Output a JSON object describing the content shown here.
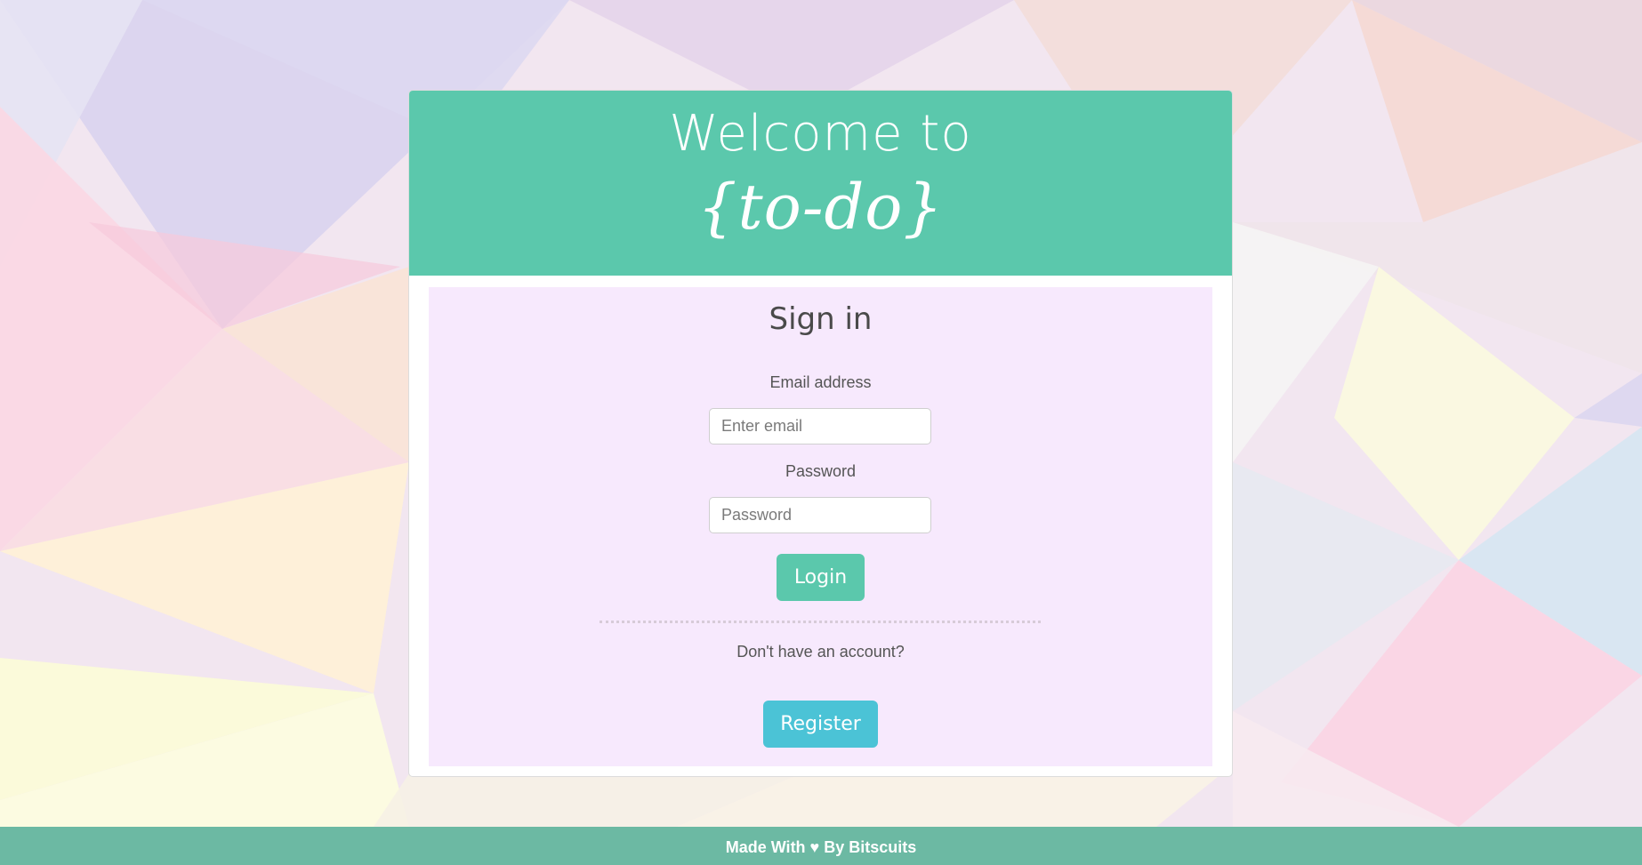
{
  "header": {
    "welcome_text": "Welcome to",
    "brand_text": "{to-do}"
  },
  "signin": {
    "title": "Sign in",
    "email": {
      "label": "Email address",
      "placeholder": "Enter email",
      "value": ""
    },
    "password": {
      "label": "Password",
      "placeholder": "Password",
      "value": ""
    },
    "login_label": "Login",
    "no_account_text": "Don't have an account?",
    "register_label": "Register"
  },
  "footer": {
    "text": "Made With ♥ By Bitscuits"
  },
  "colors": {
    "accent": "#5bc8ac",
    "register": "#4bc3d6",
    "footer": "#6cb9a3",
    "panel": "#f7e9fd"
  }
}
